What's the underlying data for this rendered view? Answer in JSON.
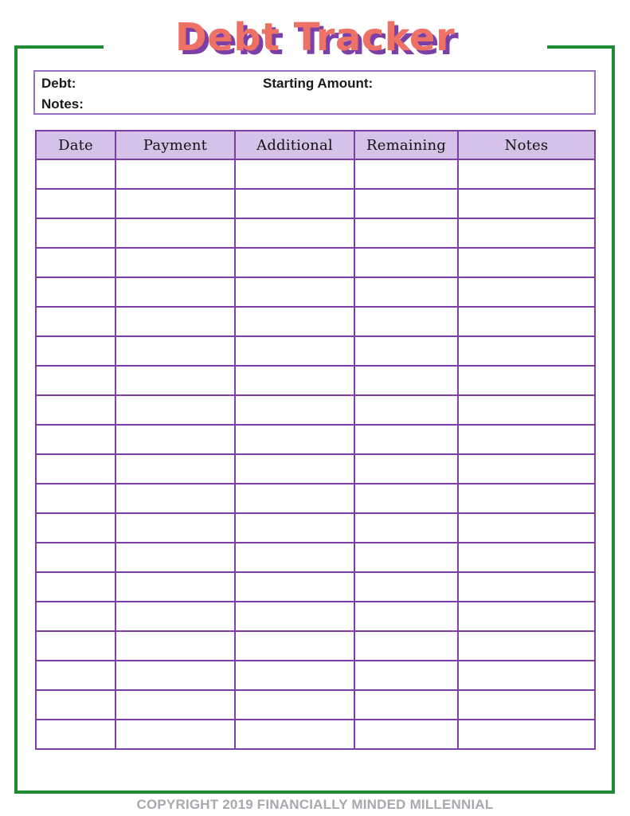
{
  "document": {
    "title": "Debt Tracker",
    "title_color": "#ED7265",
    "title_shadow_color": "#7B3FA8",
    "frame_color": "#1E8B33",
    "table_border_color": "#7D3FA6",
    "table_header_bg": "#D6C2E8",
    "info_box_border_color": "#9B6FBF"
  },
  "info_box": {
    "debt_label": "Debt:",
    "starting_amount_label": "Starting Amount:",
    "notes_label": "Notes:",
    "debt_value": "",
    "starting_amount_value": "",
    "notes_value": ""
  },
  "table": {
    "columns": [
      "Date",
      "Payment",
      "Additional",
      "Remaining",
      "Notes"
    ],
    "row_count": 20,
    "rows": [
      [
        "",
        "",
        "",
        "",
        ""
      ],
      [
        "",
        "",
        "",
        "",
        ""
      ],
      [
        "",
        "",
        "",
        "",
        ""
      ],
      [
        "",
        "",
        "",
        "",
        ""
      ],
      [
        "",
        "",
        "",
        "",
        ""
      ],
      [
        "",
        "",
        "",
        "",
        ""
      ],
      [
        "",
        "",
        "",
        "",
        ""
      ],
      [
        "",
        "",
        "",
        "",
        ""
      ],
      [
        "",
        "",
        "",
        "",
        ""
      ],
      [
        "",
        "",
        "",
        "",
        ""
      ],
      [
        "",
        "",
        "",
        "",
        ""
      ],
      [
        "",
        "",
        "",
        "",
        ""
      ],
      [
        "",
        "",
        "",
        "",
        ""
      ],
      [
        "",
        "",
        "",
        "",
        ""
      ],
      [
        "",
        "",
        "",
        "",
        ""
      ],
      [
        "",
        "",
        "",
        "",
        ""
      ],
      [
        "",
        "",
        "",
        "",
        ""
      ],
      [
        "",
        "",
        "",
        "",
        ""
      ],
      [
        "",
        "",
        "",
        "",
        ""
      ],
      [
        "",
        "",
        "",
        "",
        ""
      ]
    ]
  },
  "footer": {
    "copyright": "COPYRIGHT 2019 FINANCIALLY MINDED MILLENNIAL"
  }
}
